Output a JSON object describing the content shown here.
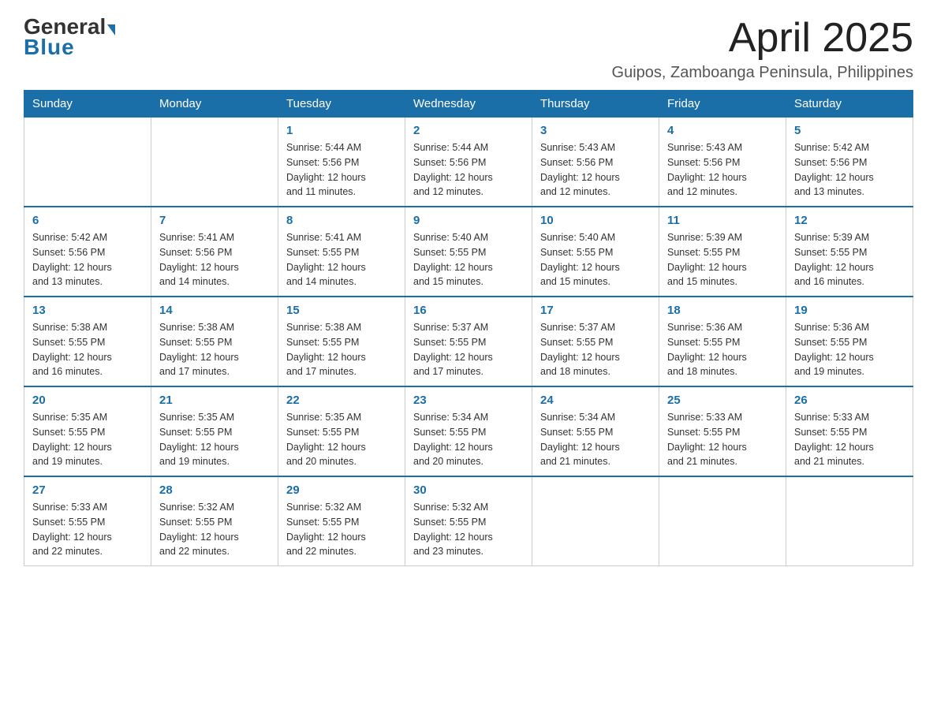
{
  "logo": {
    "general": "General",
    "triangle": "",
    "blue": "Blue"
  },
  "title": "April 2025",
  "location": "Guipos, Zamboanga Peninsula, Philippines",
  "weekdays": [
    "Sunday",
    "Monday",
    "Tuesday",
    "Wednesday",
    "Thursday",
    "Friday",
    "Saturday"
  ],
  "weeks": [
    [
      {
        "day": "",
        "info": ""
      },
      {
        "day": "",
        "info": ""
      },
      {
        "day": "1",
        "info": "Sunrise: 5:44 AM\nSunset: 5:56 PM\nDaylight: 12 hours\nand 11 minutes."
      },
      {
        "day": "2",
        "info": "Sunrise: 5:44 AM\nSunset: 5:56 PM\nDaylight: 12 hours\nand 12 minutes."
      },
      {
        "day": "3",
        "info": "Sunrise: 5:43 AM\nSunset: 5:56 PM\nDaylight: 12 hours\nand 12 minutes."
      },
      {
        "day": "4",
        "info": "Sunrise: 5:43 AM\nSunset: 5:56 PM\nDaylight: 12 hours\nand 12 minutes."
      },
      {
        "day": "5",
        "info": "Sunrise: 5:42 AM\nSunset: 5:56 PM\nDaylight: 12 hours\nand 13 minutes."
      }
    ],
    [
      {
        "day": "6",
        "info": "Sunrise: 5:42 AM\nSunset: 5:56 PM\nDaylight: 12 hours\nand 13 minutes."
      },
      {
        "day": "7",
        "info": "Sunrise: 5:41 AM\nSunset: 5:56 PM\nDaylight: 12 hours\nand 14 minutes."
      },
      {
        "day": "8",
        "info": "Sunrise: 5:41 AM\nSunset: 5:55 PM\nDaylight: 12 hours\nand 14 minutes."
      },
      {
        "day": "9",
        "info": "Sunrise: 5:40 AM\nSunset: 5:55 PM\nDaylight: 12 hours\nand 15 minutes."
      },
      {
        "day": "10",
        "info": "Sunrise: 5:40 AM\nSunset: 5:55 PM\nDaylight: 12 hours\nand 15 minutes."
      },
      {
        "day": "11",
        "info": "Sunrise: 5:39 AM\nSunset: 5:55 PM\nDaylight: 12 hours\nand 15 minutes."
      },
      {
        "day": "12",
        "info": "Sunrise: 5:39 AM\nSunset: 5:55 PM\nDaylight: 12 hours\nand 16 minutes."
      }
    ],
    [
      {
        "day": "13",
        "info": "Sunrise: 5:38 AM\nSunset: 5:55 PM\nDaylight: 12 hours\nand 16 minutes."
      },
      {
        "day": "14",
        "info": "Sunrise: 5:38 AM\nSunset: 5:55 PM\nDaylight: 12 hours\nand 17 minutes."
      },
      {
        "day": "15",
        "info": "Sunrise: 5:38 AM\nSunset: 5:55 PM\nDaylight: 12 hours\nand 17 minutes."
      },
      {
        "day": "16",
        "info": "Sunrise: 5:37 AM\nSunset: 5:55 PM\nDaylight: 12 hours\nand 17 minutes."
      },
      {
        "day": "17",
        "info": "Sunrise: 5:37 AM\nSunset: 5:55 PM\nDaylight: 12 hours\nand 18 minutes."
      },
      {
        "day": "18",
        "info": "Sunrise: 5:36 AM\nSunset: 5:55 PM\nDaylight: 12 hours\nand 18 minutes."
      },
      {
        "day": "19",
        "info": "Sunrise: 5:36 AM\nSunset: 5:55 PM\nDaylight: 12 hours\nand 19 minutes."
      }
    ],
    [
      {
        "day": "20",
        "info": "Sunrise: 5:35 AM\nSunset: 5:55 PM\nDaylight: 12 hours\nand 19 minutes."
      },
      {
        "day": "21",
        "info": "Sunrise: 5:35 AM\nSunset: 5:55 PM\nDaylight: 12 hours\nand 19 minutes."
      },
      {
        "day": "22",
        "info": "Sunrise: 5:35 AM\nSunset: 5:55 PM\nDaylight: 12 hours\nand 20 minutes."
      },
      {
        "day": "23",
        "info": "Sunrise: 5:34 AM\nSunset: 5:55 PM\nDaylight: 12 hours\nand 20 minutes."
      },
      {
        "day": "24",
        "info": "Sunrise: 5:34 AM\nSunset: 5:55 PM\nDaylight: 12 hours\nand 21 minutes."
      },
      {
        "day": "25",
        "info": "Sunrise: 5:33 AM\nSunset: 5:55 PM\nDaylight: 12 hours\nand 21 minutes."
      },
      {
        "day": "26",
        "info": "Sunrise: 5:33 AM\nSunset: 5:55 PM\nDaylight: 12 hours\nand 21 minutes."
      }
    ],
    [
      {
        "day": "27",
        "info": "Sunrise: 5:33 AM\nSunset: 5:55 PM\nDaylight: 12 hours\nand 22 minutes."
      },
      {
        "day": "28",
        "info": "Sunrise: 5:32 AM\nSunset: 5:55 PM\nDaylight: 12 hours\nand 22 minutes."
      },
      {
        "day": "29",
        "info": "Sunrise: 5:32 AM\nSunset: 5:55 PM\nDaylight: 12 hours\nand 22 minutes."
      },
      {
        "day": "30",
        "info": "Sunrise: 5:32 AM\nSunset: 5:55 PM\nDaylight: 12 hours\nand 23 minutes."
      },
      {
        "day": "",
        "info": ""
      },
      {
        "day": "",
        "info": ""
      },
      {
        "day": "",
        "info": ""
      }
    ]
  ]
}
